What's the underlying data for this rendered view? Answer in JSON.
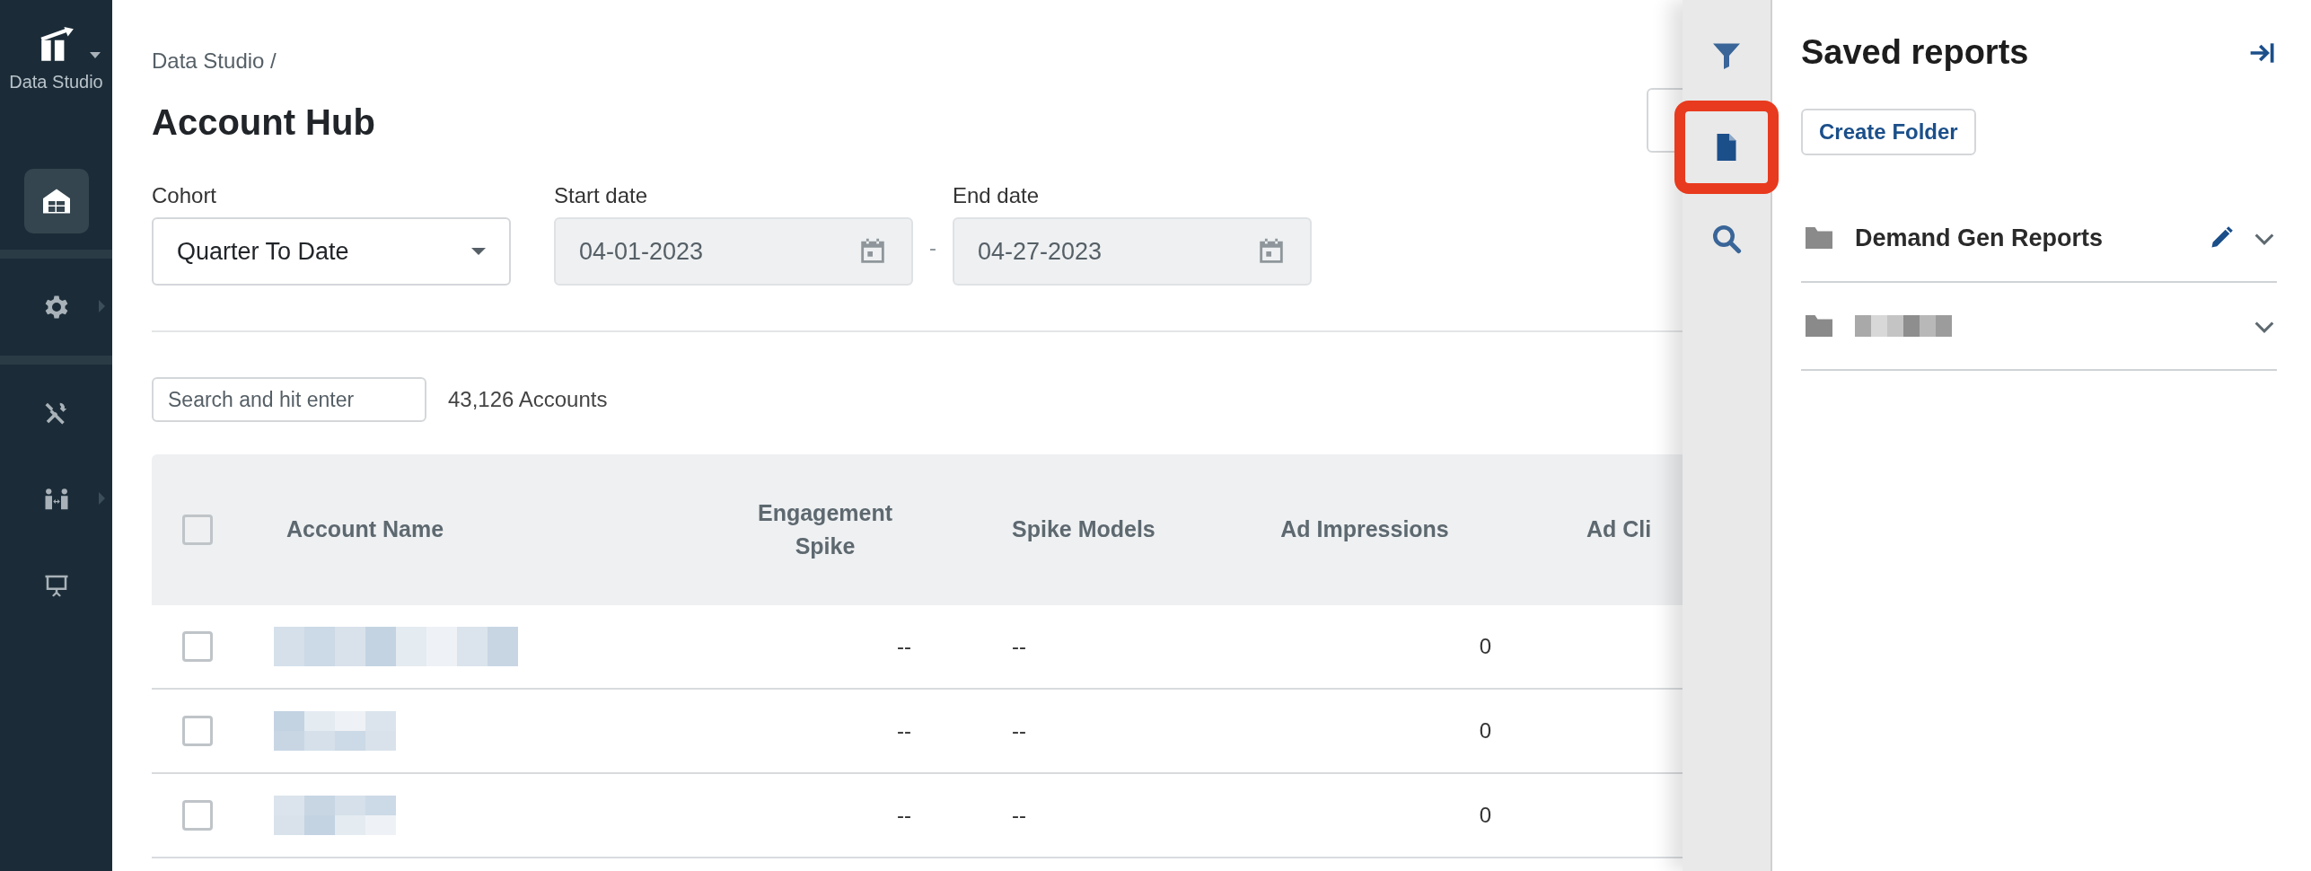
{
  "sidebar": {
    "brand": "Data Studio",
    "items": [
      {
        "kind": "item",
        "selected": true,
        "has_submenu": false
      },
      {
        "kind": "divider"
      },
      {
        "kind": "item",
        "selected": false,
        "has_submenu": true
      },
      {
        "kind": "divider"
      },
      {
        "kind": "item",
        "selected": false,
        "has_submenu": false
      },
      {
        "kind": "item",
        "selected": false,
        "has_submenu": true
      },
      {
        "kind": "item",
        "selected": false,
        "has_submenu": false
      }
    ]
  },
  "breadcrumb": "Data Studio /",
  "title": "Account Hub",
  "filters": {
    "cohort": {
      "label": "Cohort",
      "value": "Quarter To Date"
    },
    "start_date": {
      "label": "Start date",
      "value": "04-01-2023",
      "disabled": true
    },
    "separator": "-",
    "end_date": {
      "label": "End date",
      "value": "04-27-2023",
      "disabled": true
    }
  },
  "search": {
    "placeholder": "Search and hit enter"
  },
  "count": "43,126 Accounts",
  "table": {
    "select_all_checked": false,
    "columns": [
      "Account Name",
      "Engagement Spike",
      "Spike Models",
      "Ad Impressions",
      "Ad Cli"
    ],
    "rows": [
      {
        "checked": false,
        "name_redacted": true,
        "engagement_spike": "--",
        "spike_models": "--",
        "ad_impressions": "0"
      },
      {
        "checked": false,
        "name_redacted": true,
        "engagement_spike": "--",
        "spike_models": "--",
        "ad_impressions": "0"
      },
      {
        "checked": false,
        "name_redacted": true,
        "engagement_spike": "--",
        "spike_models": "--",
        "ad_impressions": "0"
      }
    ]
  },
  "drawer": {
    "tools": [
      {
        "selected": false,
        "highlighted": false
      },
      {
        "selected": true,
        "highlighted": true
      },
      {
        "selected": false,
        "highlighted": false
      }
    ],
    "title": "Saved reports",
    "create_button": "Create Folder",
    "folders": [
      {
        "name": "Demand Gen Reports",
        "name_redacted": false,
        "editable": true,
        "expanded": false
      },
      {
        "name_redacted": true,
        "editable": false,
        "expanded": false
      }
    ]
  }
}
